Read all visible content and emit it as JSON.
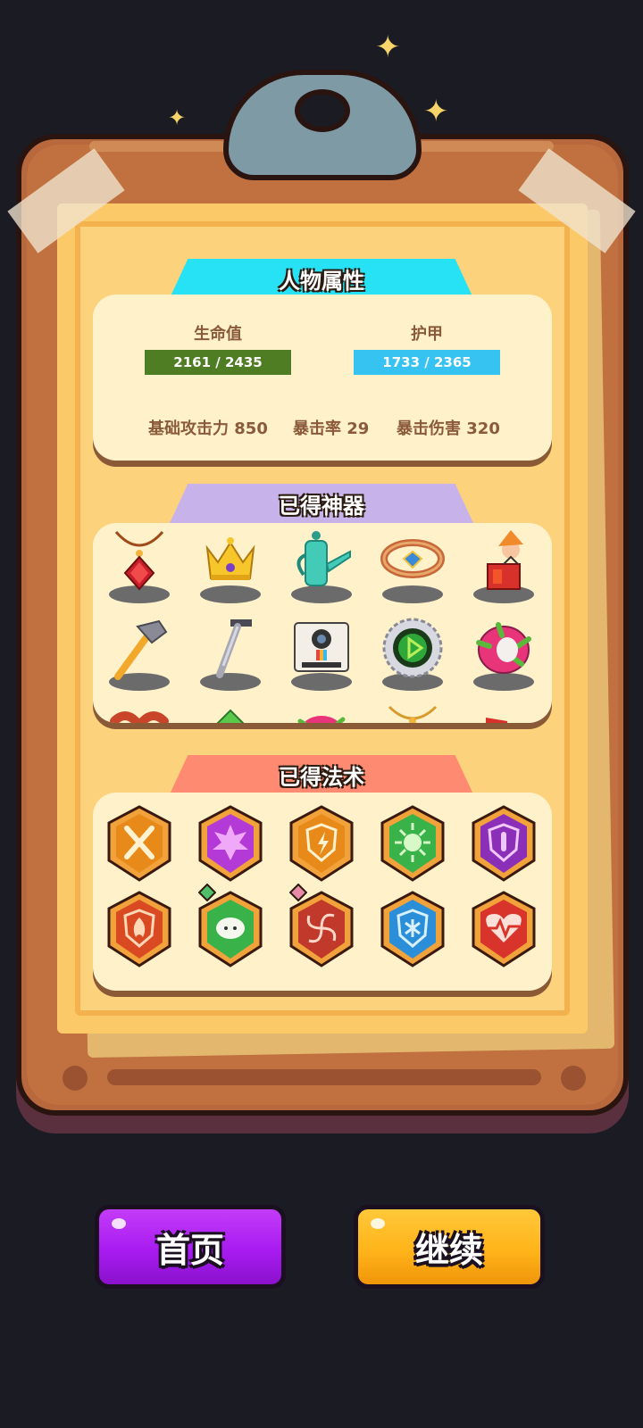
{
  "colors": {
    "background": "#1b1b24",
    "board": "#b7683d",
    "paper": "#fcc968",
    "panel": "#fff2cb",
    "attr_tab": "#27e2f4",
    "artifact_tab": "#c7b3ea",
    "spell_tab": "#ff8a72",
    "hp_bar": "#4f7d24",
    "armor_bar": "#36c3f2",
    "home_button": "#a81bf0",
    "continue_button": "#ffb419"
  },
  "attributes": {
    "title": "人物属性",
    "hp": {
      "label": "生命值",
      "value": "2161 / 2435",
      "current": 2161,
      "max": 2435
    },
    "armor": {
      "label": "护甲",
      "value": "1733 / 2365",
      "current": 1733,
      "max": 2365
    },
    "base_attack": "基础攻击力 850",
    "crit_rate": "暴击率 29",
    "crit_damage": "暴击伤害 320"
  },
  "artifacts": {
    "title": "已得神器",
    "items": [
      {
        "icon": "red-gem-necklace-icon"
      },
      {
        "icon": "gold-crown-icon"
      },
      {
        "icon": "watering-can-icon"
      },
      {
        "icon": "sapphire-ring-icon"
      },
      {
        "icon": "jack-in-the-box-icon"
      },
      {
        "icon": "hammer-icon"
      },
      {
        "icon": "razor-icon"
      },
      {
        "icon": "instant-camera-icon"
      },
      {
        "icon": "green-saw-blade-icon"
      },
      {
        "icon": "dragon-fruit-icon"
      },
      {
        "icon": "sausage-icon"
      },
      {
        "icon": "green-gem-icon"
      },
      {
        "icon": "dragon-fruit-icon"
      },
      {
        "icon": "gold-necklace-icon"
      },
      {
        "icon": "red-item-icon"
      }
    ]
  },
  "spells": {
    "title": "已得法术",
    "items": [
      {
        "icon": "crossed-swords-icon",
        "color": "#f2a23a",
        "gem": false
      },
      {
        "icon": "crit-burst-icon",
        "color": "#b43ad8",
        "gem": false
      },
      {
        "icon": "lightning-shield-icon",
        "color": "#f2a23a",
        "gem": false
      },
      {
        "icon": "skull-burst-icon",
        "color": "#39b24a",
        "gem": false
      },
      {
        "icon": "potion-shield-icon",
        "color": "#8c2fb8",
        "gem": false
      },
      {
        "icon": "fire-shield-icon",
        "color": "#d94a23",
        "gem": false
      },
      {
        "icon": "sheep-icon",
        "color": "#39b24a",
        "gem": true,
        "gem_color": "#4fbf6a"
      },
      {
        "icon": "whirlwind-icon",
        "color": "#c0392b",
        "gem": true,
        "gem_color": "#e88aa8"
      },
      {
        "icon": "snowflake-shield-icon",
        "color": "#2a8fd8",
        "gem": false
      },
      {
        "icon": "heartbeat-icon",
        "color": "#d9342b",
        "gem": false
      }
    ]
  },
  "buttons": {
    "home": "首页",
    "continue": "继续"
  }
}
